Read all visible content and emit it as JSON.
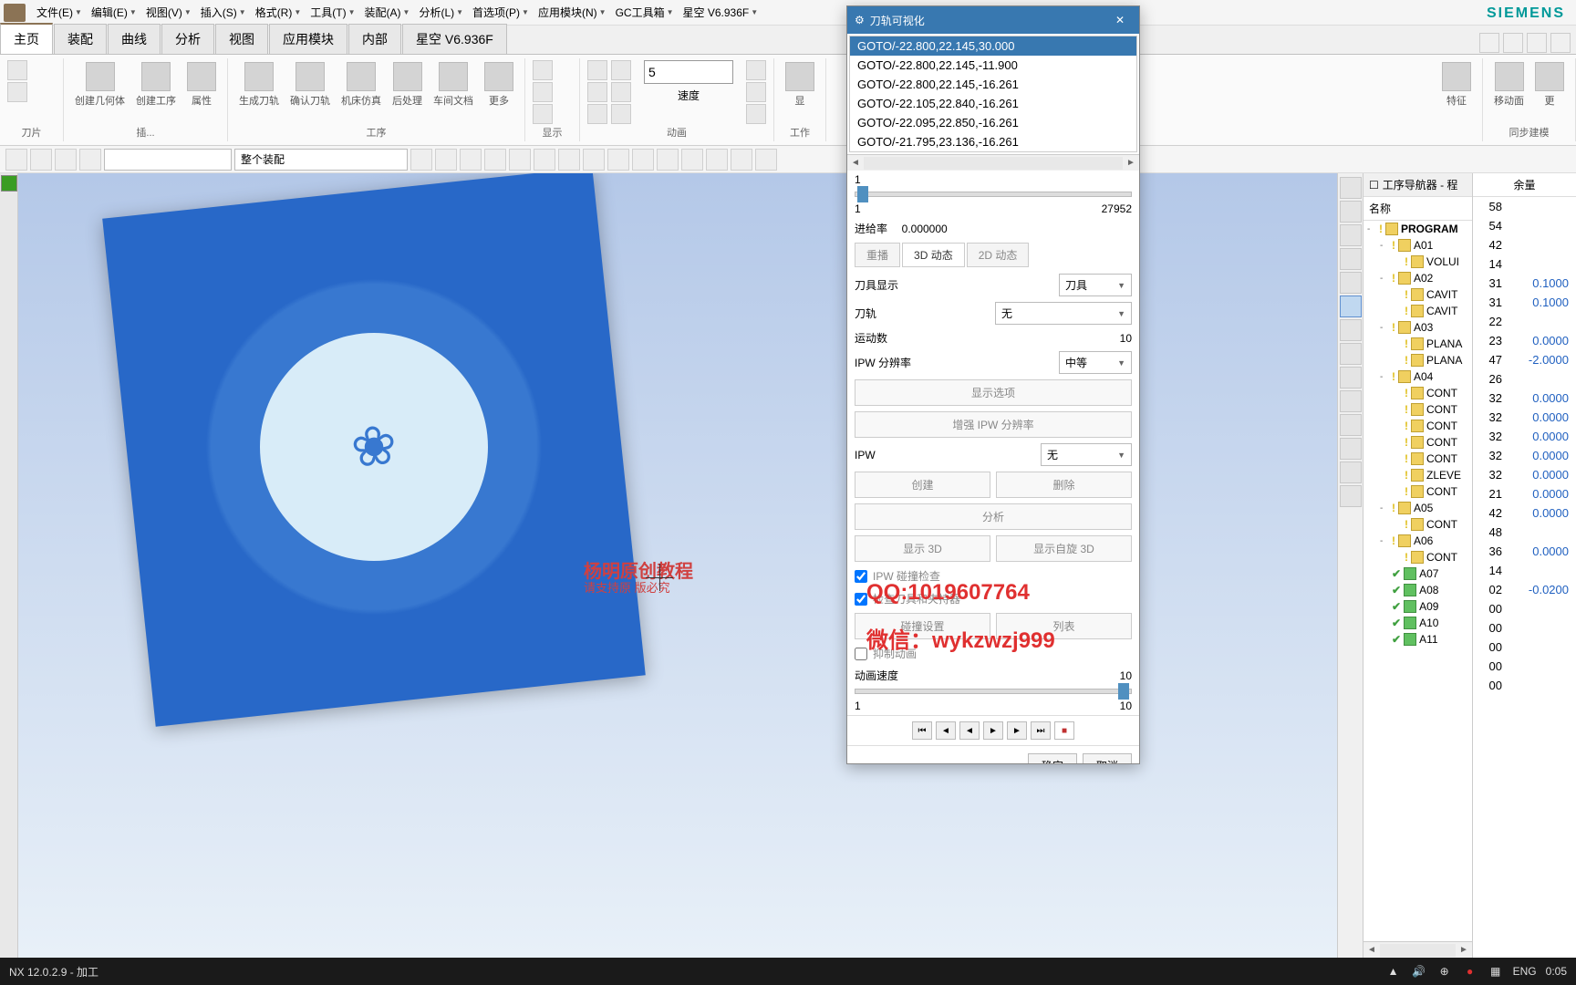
{
  "brand": "SIEMENS",
  "menus": [
    "文件(E)",
    "编辑(E)",
    "视图(V)",
    "插入(S)",
    "格式(R)",
    "工具(T)",
    "装配(A)",
    "分析(L)",
    "首选项(P)",
    "应用模块(N)",
    "GC工具箱",
    "星空 V6.936F"
  ],
  "ribbon_tabs": [
    "主页",
    "装配",
    "曲线",
    "分析",
    "视图",
    "应用模块",
    "内部",
    "星空 V6.936F"
  ],
  "ribbon": {
    "group_knife": "刀片",
    "group_insert": "插...",
    "group_process": "工序",
    "group_display": "显示",
    "group_anim": "动画",
    "group_proc2": "工作",
    "group_feature": "特征",
    "group_sync": "同步建模",
    "btn_create_geom": "创建几何体",
    "btn_create_prog": "创建工序",
    "btn_props": "属性",
    "btn_gen_tool": "生成刀轨",
    "btn_confirm_tool": "确认刀轨",
    "btn_machine_sim": "机床仿真",
    "btn_post": "后处理",
    "btn_shop_doc": "车间文档",
    "btn_more": "更多",
    "btn_speed": "速度",
    "btn_show": "显",
    "btn_move_face": "移动面",
    "btn_more2": "更"
  },
  "speed_value": "5",
  "assembly_combo": "整个装配",
  "nav": {
    "title": "工序导航器 - 程",
    "col_name": "名称",
    "col_remain": "余量",
    "items": [
      {
        "exp": "-",
        "status": "!",
        "label": "PROGRAM",
        "lvl": 0,
        "bold": true
      },
      {
        "exp": "-",
        "status": "!",
        "label": "A01",
        "lvl": 1
      },
      {
        "exp": "",
        "status": "!",
        "label": "VOLUI",
        "lvl": 2,
        "icon": "v"
      },
      {
        "exp": "-",
        "status": "!",
        "label": "A02",
        "lvl": 1
      },
      {
        "exp": "",
        "status": "!",
        "label": "CAVIT",
        "lvl": 2,
        "icon": "c"
      },
      {
        "exp": "",
        "status": "!",
        "label": "CAVIT",
        "lvl": 2,
        "icon": "c"
      },
      {
        "exp": "-",
        "status": "!",
        "label": "A03",
        "lvl": 1
      },
      {
        "exp": "",
        "status": "!",
        "label": "PLANA",
        "lvl": 2,
        "icon": "p"
      },
      {
        "exp": "",
        "status": "!",
        "label": "PLANA",
        "lvl": 2,
        "icon": "p"
      },
      {
        "exp": "-",
        "status": "!",
        "label": "A04",
        "lvl": 1
      },
      {
        "exp": "",
        "status": "!",
        "label": "CONT",
        "lvl": 2,
        "icon": "c"
      },
      {
        "exp": "",
        "status": "!",
        "label": "CONT",
        "lvl": 2,
        "icon": "c"
      },
      {
        "exp": "",
        "status": "!",
        "label": "CONT",
        "lvl": 2,
        "icon": "c"
      },
      {
        "exp": "",
        "status": "!",
        "label": "CONT",
        "lvl": 2,
        "icon": "c"
      },
      {
        "exp": "",
        "status": "!",
        "label": "CONT",
        "lvl": 2,
        "icon": "c"
      },
      {
        "exp": "",
        "status": "!",
        "label": "ZLEVE",
        "lvl": 2,
        "icon": "z"
      },
      {
        "exp": "",
        "status": "!",
        "label": "CONT",
        "lvl": 2,
        "icon": "c"
      },
      {
        "exp": "-",
        "status": "!",
        "label": "A05",
        "lvl": 1
      },
      {
        "exp": "",
        "status": "!",
        "label": "CONT",
        "lvl": 2,
        "icon": "c"
      },
      {
        "exp": "-",
        "status": "!",
        "label": "A06",
        "lvl": 1
      },
      {
        "exp": "",
        "status": "!",
        "label": "CONT",
        "lvl": 2,
        "icon": "c"
      },
      {
        "exp": "",
        "status": "ok",
        "label": "A07",
        "lvl": 1
      },
      {
        "exp": "",
        "status": "ok",
        "label": "A08",
        "lvl": 1
      },
      {
        "exp": "",
        "status": "ok",
        "label": "A09",
        "lvl": 1
      },
      {
        "exp": "",
        "status": "ok",
        "label": "A10",
        "lvl": 1
      },
      {
        "exp": "",
        "status": "ok",
        "label": "A11",
        "lvl": 1
      }
    ]
  },
  "dialog": {
    "title": "刀轨可视化",
    "goto_lines": [
      "GOTO/-22.800,22.145,30.000",
      "GOTO/-22.800,22.145,-11.900",
      "GOTO/-22.800,22.145,-16.261",
      "GOTO/-22.105,22.840,-16.261",
      "GOTO/-22.095,22.850,-16.261",
      "GOTO/-21.795,23.136,-16.261"
    ],
    "line_min": "1",
    "line_cur": "1",
    "line_max": "27952",
    "feed_label": "进给率",
    "feed_value": "0.000000",
    "tab_replay": "重播",
    "tab_3d": "3D 动态",
    "tab_2d": "2D 动态",
    "tool_display": "刀具显示",
    "tool_opt": "刀具",
    "tool_path": "刀轨",
    "none": "无",
    "motion_count": "运动数",
    "motion_val": "10",
    "ipw_res": "IPW 分辨率",
    "medium": "中等",
    "show_options": "显示选项",
    "enhance_ipw": "增强 IPW 分辨率",
    "ipw": "IPW",
    "create": "创建",
    "delete": "删除",
    "analyze": "分析",
    "show_3d": "显示 3D",
    "show_spin_3d": "显示自旋 3D",
    "ipw_collision": "IPW 碰撞检查",
    "check_tool_holder": "检查刀具和夹持器",
    "collision_settings": "碰撞设置",
    "list": "列表",
    "suppress_anim": "抑制动画",
    "anim_speed": "动画速度",
    "speed_min": "1",
    "speed_max": "10",
    "ok": "确定",
    "cancel": "取消"
  },
  "right_data": {
    "vals": [
      "58",
      "54",
      "42",
      "14",
      "31",
      "31",
      "22",
      "23",
      "47",
      "26",
      "32",
      "32",
      "32",
      "32",
      "32",
      "21",
      "42",
      "48",
      "36",
      "14",
      "02",
      "00",
      "00",
      "00",
      "00",
      "00"
    ],
    "remain": [
      "",
      "",
      "",
      "",
      "0.1000",
      "0.1000",
      "",
      "0.0000",
      "-2.0000",
      "",
      "0.0000",
      "0.0000",
      "0.0000",
      "0.0000",
      "0.0000",
      "0.0000",
      "0.0000",
      "",
      "0.0000",
      "",
      "-0.0200",
      "",
      "",
      "",
      "",
      ""
    ]
  },
  "watermark": {
    "line1": "杨明原创教程",
    "line2": "请支持原    版必究",
    "qq": "QQ:1019607764",
    "wechat": "微信：wykzwzj999"
  },
  "status": "NX 12.0.2.9 - 加工",
  "taskbar": {
    "lang": "ENG",
    "time": "0:05"
  }
}
